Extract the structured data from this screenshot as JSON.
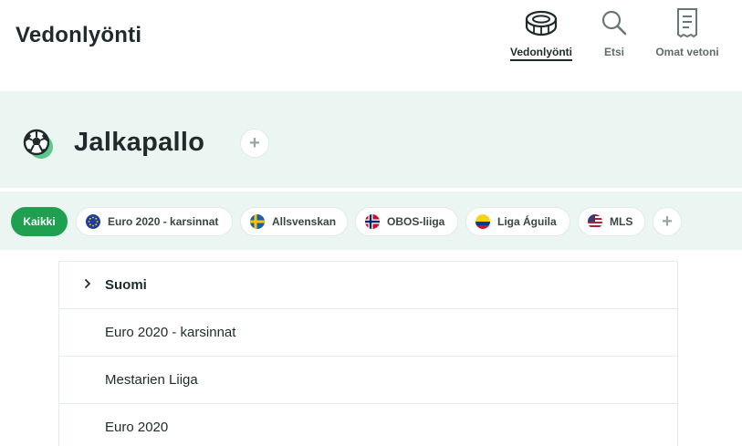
{
  "header": {
    "title": "Vedonlyönti",
    "nav": [
      {
        "label": "Vedonlyönti",
        "icon": "stadium-icon",
        "active": true
      },
      {
        "label": "Etsi",
        "icon": "search-icon",
        "active": false
      },
      {
        "label": "Omat vetoni",
        "icon": "receipt-icon",
        "active": false
      }
    ]
  },
  "hero": {
    "sport_title": "Jalkapallo",
    "sport_icon": "football-icon",
    "favorite_symbol": "+"
  },
  "filters": {
    "all_label": "Kaikki",
    "chips": [
      {
        "label": "Euro 2020 - karsinnat",
        "icon": "eu-flag-icon"
      },
      {
        "label": "Allsvenskan",
        "icon": "sweden-flag-icon"
      },
      {
        "label": "OBOS-liiga",
        "icon": "norway-flag-icon"
      },
      {
        "label": "Liga Águila",
        "icon": "colombia-flag-icon"
      },
      {
        "label": "MLS",
        "icon": "usa-flag-icon"
      }
    ],
    "add_symbol": "+"
  },
  "competitions": [
    {
      "label": "Suomi",
      "expandable": true
    },
    {
      "label": "Euro 2020 - karsinnat",
      "expandable": false
    },
    {
      "label": "Mestarien Liiga",
      "expandable": false
    },
    {
      "label": "Euro 2020",
      "expandable": false
    }
  ],
  "colors": {
    "accent": "#1fa050",
    "hero_bg": "#ebf5f2",
    "text": "#1f2a2a"
  }
}
